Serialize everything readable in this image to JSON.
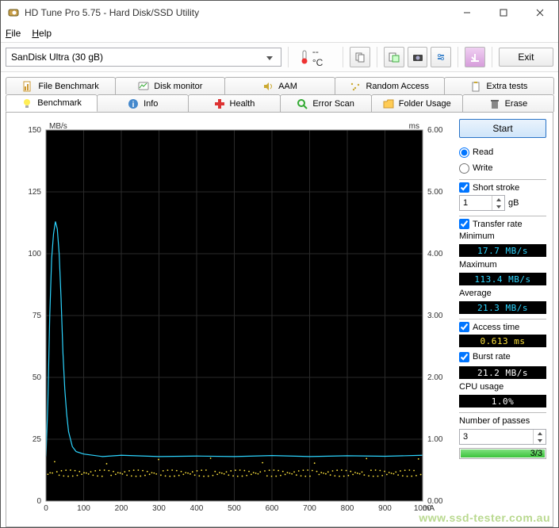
{
  "window": {
    "title": "HD Tune Pro 5.75 - Hard Disk/SSD Utility"
  },
  "menu": {
    "file": "File",
    "help": "Help"
  },
  "toolbar": {
    "device": "SanDisk Ultra (30 gB)",
    "temp": "-- °C",
    "exit": "Exit"
  },
  "tabs_top": [
    {
      "id": "filebench",
      "label": "File Benchmark"
    },
    {
      "id": "diskmon",
      "label": "Disk monitor"
    },
    {
      "id": "aam",
      "label": "AAM"
    },
    {
      "id": "random",
      "label": "Random Access"
    },
    {
      "id": "extra",
      "label": "Extra tests"
    }
  ],
  "tabs_bottom": [
    {
      "id": "bench",
      "label": "Benchmark"
    },
    {
      "id": "info",
      "label": "Info"
    },
    {
      "id": "health",
      "label": "Health"
    },
    {
      "id": "error",
      "label": "Error Scan"
    },
    {
      "id": "folder",
      "label": "Folder Usage"
    },
    {
      "id": "erase",
      "label": "Erase"
    }
  ],
  "sidebar": {
    "start": "Start",
    "read": "Read",
    "write": "Write",
    "short_stroke": "Short stroke",
    "short_val": "1",
    "short_unit": "gB",
    "transfer_rate": "Transfer rate",
    "minimum_label": "Minimum",
    "minimum_val": "17.7 MB/s",
    "maximum_label": "Maximum",
    "maximum_val": "113.4 MB/s",
    "average_label": "Average",
    "average_val": "21.3 MB/s",
    "access_time": "Access time",
    "access_val": "0.613 ms",
    "burst_rate": "Burst rate",
    "burst_val": "21.2 MB/s",
    "cpu_label": "CPU usage",
    "cpu_val": "1.0%",
    "passes_label": "Number of passes",
    "passes_val": "3",
    "progress": "3/3"
  },
  "chart_data": {
    "type": "line",
    "y_left_label": "MB/s",
    "y_left_range": [
      0,
      150
    ],
    "y_left_ticks": [
      0,
      25,
      50,
      75,
      100,
      125,
      150
    ],
    "y_right_label": "ms",
    "y_right_range": [
      0,
      6
    ],
    "y_right_ticks": [
      0.0,
      1.0,
      2.0,
      3.0,
      4.0,
      5.0,
      6.0
    ],
    "x_label": "mA",
    "x_range": [
      0,
      1000
    ],
    "x_ticks": [
      0,
      100,
      200,
      300,
      400,
      500,
      600,
      700,
      800,
      900,
      1000
    ],
    "series": [
      {
        "name": "transfer_rate",
        "axis": "left",
        "color": "#2dd5ff",
        "x": [
          0,
          5,
          10,
          15,
          20,
          25,
          30,
          35,
          40,
          45,
          50,
          55,
          60,
          70,
          80,
          100,
          150,
          200,
          300,
          400,
          500,
          600,
          700,
          800,
          900,
          1000
        ],
        "values": [
          18,
          40,
          75,
          98,
          108,
          113,
          110,
          100,
          82,
          60,
          45,
          35,
          28,
          22,
          20,
          19,
          18,
          18.5,
          18,
          18.2,
          18,
          18.4,
          18,
          18.3,
          18.1,
          18.5
        ]
      },
      {
        "name": "access_time",
        "axis": "right",
        "color": "#ffe43d",
        "x": [
          0,
          50,
          100,
          150,
          200,
          250,
          300,
          350,
          400,
          450,
          500,
          550,
          600,
          650,
          700,
          750,
          800,
          850,
          900,
          950,
          1000
        ],
        "values": [
          0.55,
          0.5,
          0.5,
          0.55,
          0.5,
          0.55,
          0.5,
          0.55,
          0.5,
          0.55,
          0.5,
          0.55,
          0.5,
          0.55,
          0.5,
          0.55,
          0.5,
          0.55,
          0.5,
          0.55,
          0.5
        ]
      }
    ]
  },
  "watermark": "www.ssd-tester.com.au"
}
